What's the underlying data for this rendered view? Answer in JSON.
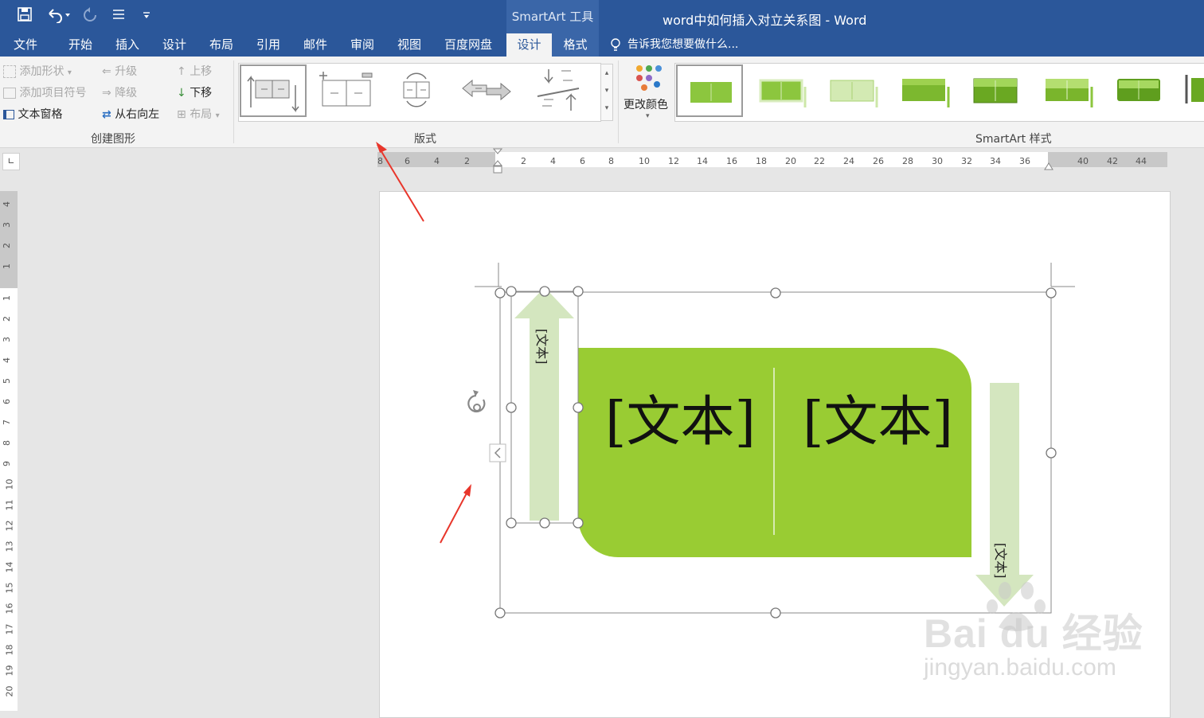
{
  "window": {
    "title": "word中如何插入对立关系图 - Word",
    "context_group": "SmartArt 工具"
  },
  "tabs": [
    "文件",
    "开始",
    "插入",
    "设计",
    "布局",
    "引用",
    "邮件",
    "审阅",
    "视图",
    "百度网盘",
    "设计",
    "格式"
  ],
  "tell_me": "告诉我您想要做什么...",
  "create_graphic": {
    "label": "创建图形",
    "add_shape": "添加形状",
    "add_bullet": "添加项目符号",
    "text_pane": "文本窗格",
    "promote": "升级",
    "demote": "降级",
    "right_to_left": "从右向左",
    "move_up": "上移",
    "move_down": "下移",
    "layout": "布局"
  },
  "layouts": {
    "label": "版式"
  },
  "styles": {
    "label": "SmartArt 样式",
    "change_colors": "更改颜色"
  },
  "smartart": {
    "text_main_1": "[文本]",
    "text_main_2": "[文本]",
    "text_arrow_up": "[文本]",
    "text_arrow_down": "[文本]"
  },
  "h_ruler": [
    "8",
    "6",
    "4",
    "2",
    "2",
    "4",
    "6",
    "8",
    "10",
    "12",
    "14",
    "16",
    "18",
    "20",
    "22",
    "24",
    "26",
    "28",
    "30",
    "32",
    "34",
    "36",
    "40",
    "42",
    "44"
  ],
  "v_ruler": [
    "4",
    "3",
    "2",
    "1",
    "1",
    "2",
    "3",
    "4",
    "5",
    "6",
    "7",
    "8",
    "9",
    "10",
    "11",
    "12",
    "13",
    "14",
    "15",
    "16",
    "17",
    "18",
    "19",
    "20"
  ],
  "watermark": {
    "brand": "Bai du 经验",
    "url": "jingyan.baidu.com"
  },
  "colors": {
    "accent": "#2b579a",
    "shape_green": "#99cc33",
    "arrow_green": "#d4e6bf"
  }
}
